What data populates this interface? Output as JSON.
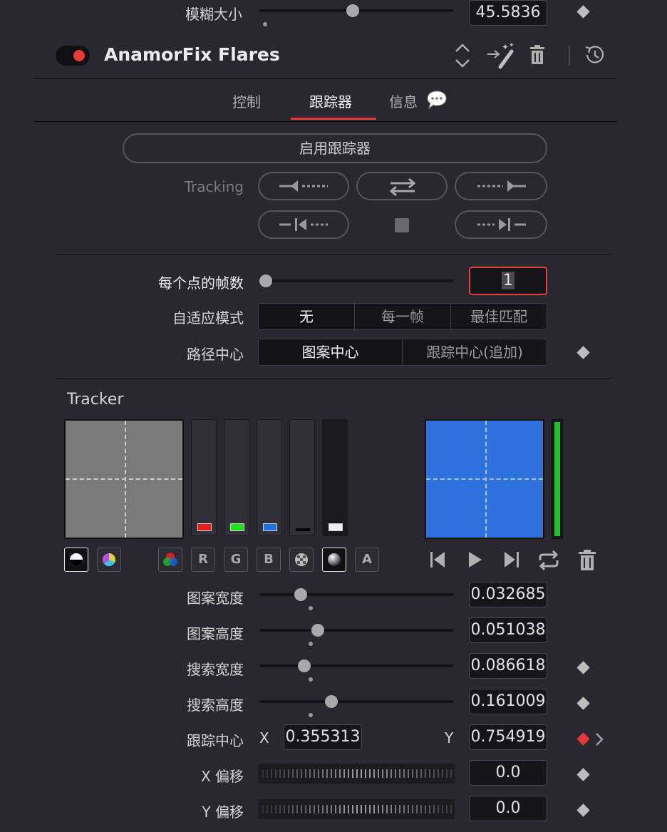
{
  "blur": {
    "label": "模糊大小",
    "value": "45.5836",
    "slider": 0.45
  },
  "effect": {
    "title": "AnamorFix Flares",
    "enabled": true
  },
  "tabs": [
    {
      "label": "控制",
      "active": false
    },
    {
      "label": "跟踪器",
      "active": true
    },
    {
      "label": "信息",
      "active": false
    }
  ],
  "tracker_controls": {
    "enable_button": "启用跟踪器",
    "tracking_label": "Tracking"
  },
  "frames_per_point": {
    "label": "每个点的帧数",
    "value": "1",
    "slider": 0.0
  },
  "adaptive_mode": {
    "label": "自适应模式",
    "options": [
      "无",
      "每一帧",
      "最佳匹配"
    ],
    "selected": 0
  },
  "path_center": {
    "label": "路径中心",
    "options": [
      "图案中心",
      "跟踪中心(追加)"
    ],
    "selected": 0
  },
  "tracker_section": {
    "title": "Tracker",
    "channel_buttons": [
      "R",
      "G",
      "B",
      "A"
    ]
  },
  "params": [
    {
      "label": "图案宽度",
      "value": "0.032685",
      "slider": 0.18,
      "keyframe": false
    },
    {
      "label": "图案高度",
      "value": "0.051038",
      "slider": 0.27,
      "keyframe": false
    },
    {
      "label": "搜索宽度",
      "value": "0.086618",
      "slider": 0.2,
      "keyframe": true
    },
    {
      "label": "搜索高度",
      "value": "0.161009",
      "slider": 0.34,
      "keyframe": true
    }
  ],
  "track_center": {
    "label": "跟踪中心",
    "x_label": "X",
    "x_value": "0.355313",
    "y_label": "Y",
    "y_value": "0.754919"
  },
  "offsets": [
    {
      "label": "X 偏移",
      "value": "0.0"
    },
    {
      "label": "Y 偏移",
      "value": "0.0"
    }
  ],
  "colors": {
    "accent_red": "#e23a3a",
    "preview_blue": "#2f72dc",
    "green_meter": "#22c02a"
  }
}
